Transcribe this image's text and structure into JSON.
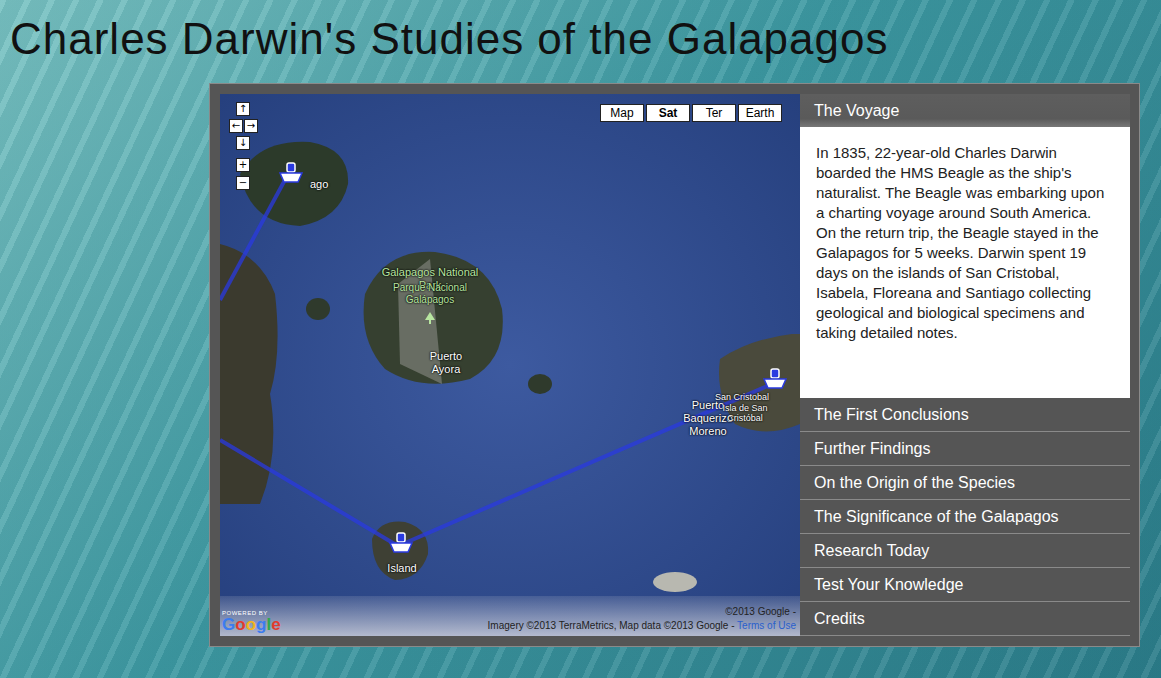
{
  "page": {
    "title": "Charles Darwin's Studies of the Galapagos"
  },
  "map": {
    "type_buttons": [
      {
        "label": "Map",
        "selected": false
      },
      {
        "label": "Sat",
        "selected": true
      },
      {
        "label": "Ter",
        "selected": false
      },
      {
        "label": "Earth",
        "selected": false
      }
    ],
    "pan_controls": [
      "↑",
      "←",
      "→",
      "↓"
    ],
    "zoom_controls": [
      "+",
      "−"
    ],
    "labels": [
      "ago",
      "Galapagos National Park",
      "Parque Nacional Galápagos",
      "Puerto Ayora",
      "Puerto Baquerizo Moreno",
      "San Cristobal",
      "Isla de San Cristóbal",
      "Island"
    ],
    "powered_by": "POWERED BY",
    "logo": "Google",
    "attribution": {
      "line1": "©2013 Google -",
      "line2": "Imagery ©2013 TerraMetrics, Map data ©2013 Google - ",
      "terms": "Terms of Use"
    }
  },
  "accordion": [
    {
      "title": "The Voyage",
      "expanded": true,
      "body": "In 1835, 22-year-old Charles Darwin boarded the HMS Beagle as the ship's naturalist. The Beagle was embarking upon a charting voyage around South America. On the return trip, the Beagle stayed in the Galapagos for 5 weeks. Darwin spent 19 days on the islands of San Cristobal, Isabela, Floreana and Santiago collecting geological and biological specimens and taking detailed notes."
    },
    {
      "title": "The First Conclusions",
      "expanded": false,
      "body": ""
    },
    {
      "title": "Further Findings",
      "expanded": false,
      "body": ""
    },
    {
      "title": "On the Origin of the Species",
      "expanded": false,
      "body": ""
    },
    {
      "title": "The Significance of the Galapagos",
      "expanded": false,
      "body": ""
    },
    {
      "title": "Research Today",
      "expanded": false,
      "body": ""
    },
    {
      "title": "Test Your Knowledge",
      "expanded": false,
      "body": ""
    },
    {
      "title": "Credits",
      "expanded": false,
      "body": ""
    }
  ]
}
